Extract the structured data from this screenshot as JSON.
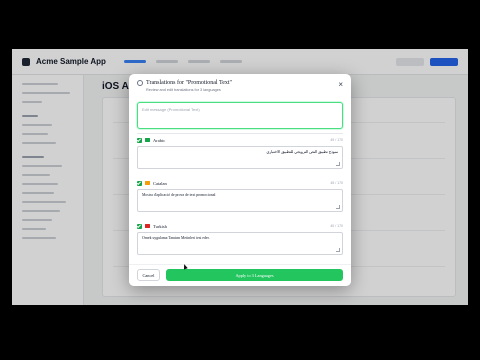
{
  "app": {
    "name": "Acme Sample App",
    "main_title": "iOS App"
  },
  "modal": {
    "title": "Translations for \"Promotional Text\"",
    "subtitle": "Review and edit translations for 3 languages",
    "source_placeholder": "Edit message (Promotional Text)",
    "close_label": "×",
    "languages": [
      {
        "name": "Arabic",
        "count": "49 / 170",
        "text": "نموذج تطبيق النص الترويجي للتطبيق الاختباري",
        "flag_color": "#16a34a"
      },
      {
        "name": "Catalan",
        "count": "45 / 170",
        "text": "Mostra d'aplicació de prova de text promocional",
        "flag_color": "#f59e0b"
      },
      {
        "name": "Turkish",
        "count": "40 / 170",
        "text": "Örnek uygulama Tanıtım Metinleri test eder.",
        "flag_color": "#dc2626"
      }
    ],
    "cancel_label": "Cancel",
    "apply_label": "Apply to 3 Languages"
  },
  "colors": {
    "accent_green": "#22c55e",
    "focus_green": "#4ade80"
  }
}
